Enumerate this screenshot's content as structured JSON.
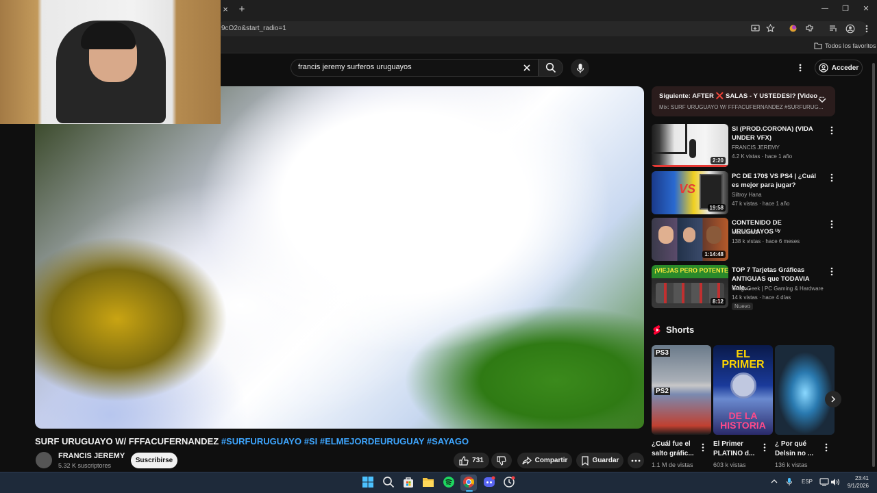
{
  "browser": {
    "tab_close": "×",
    "tab_new": "+",
    "url": "9cO2o&start_radio=1",
    "window_controls": [
      "—",
      "❐",
      "✕"
    ],
    "bookmarks_label": "Todos los favoritos"
  },
  "youtube": {
    "search_query": "francis jeremy surferos uruguayos",
    "signin_label": "Acceder",
    "video": {
      "title_main": "SURF URUGUAYO W/ FFFACUFERNANDEZ",
      "hashtags": [
        "#SURFURUGUAYO",
        "#SI",
        "#ELMEJORDEURUGUAY",
        "#SAYAGO"
      ],
      "channel": "FRANCIS JEREMY",
      "subscribers": "5.32 K suscriptores",
      "subscribe_label": "Suscribirse",
      "likes": "731",
      "share_label": "Compartir",
      "save_label": "Guardar"
    },
    "next": {
      "label": "Siguiente: AFTER ❌ SALAS - Y USTEDESI? [Video ...",
      "mix": "Mix: SURF URUGUAYO W/ FFFACUFERNANDEZ #SURFURUG..."
    },
    "recommendations": [
      {
        "title": "SI (PROD.CORONA) (VIDA UNDER VFX)",
        "channel": "FRANCIS JEREMY",
        "meta": "4.2 K vistas · hace 1 año",
        "duration": "2:20",
        "badge": ""
      },
      {
        "title": "PC DE 170$ VS PS4 | ¿Cuál es mejor para jugar?",
        "channel": "Siltroy Hana",
        "meta": "47 k vistas · hace 1 año",
        "duration": "19:58",
        "badge": ""
      },
      {
        "title": "CONTENIDO DE URUGUAYOS ᵁʸ",
        "channel": "Nachoide3",
        "meta": "138 k vistas · hace 6 meses",
        "duration": "1:14:48",
        "badge": ""
      },
      {
        "title": "TOP 7 Tarjetas Gráficas ANTIGUAS que TODAVIA Vale...",
        "channel": "GregoGeek | PC Gaming & Hardware",
        "meta": "14 k vistas · hace 4 días",
        "duration": "8:12",
        "badge": "Nuevo"
      }
    ],
    "thumb_texts": {
      "vs": "VS",
      "viejas": "¡VIEJAS PERO POTENTES!"
    },
    "shorts_label": "Shorts",
    "shorts": [
      {
        "title": "¿Cuál fue el salto gráfic...",
        "views": "1.1 M de vistas",
        "thumb_text_a": "PS3",
        "thumb_text_b": "PS2"
      },
      {
        "title": "El Primer PLATINO d...",
        "views": "603 k vistas",
        "thumb_text_a": "EL PRIMER",
        "thumb_text_b": "DE LA HISTORIA"
      },
      {
        "title": "¿ Por qué Delsin no ...",
        "views": "136 k vistas",
        "thumb_text_a": "",
        "thumb_text_b": ""
      }
    ]
  },
  "taskbar": {
    "language": "ESP",
    "time": "23:41",
    "date": "9/1/2026"
  },
  "colors": {
    "background": "#0f0f0f",
    "link": "#3ea6ff",
    "taskbar": "#1e2a3a"
  }
}
